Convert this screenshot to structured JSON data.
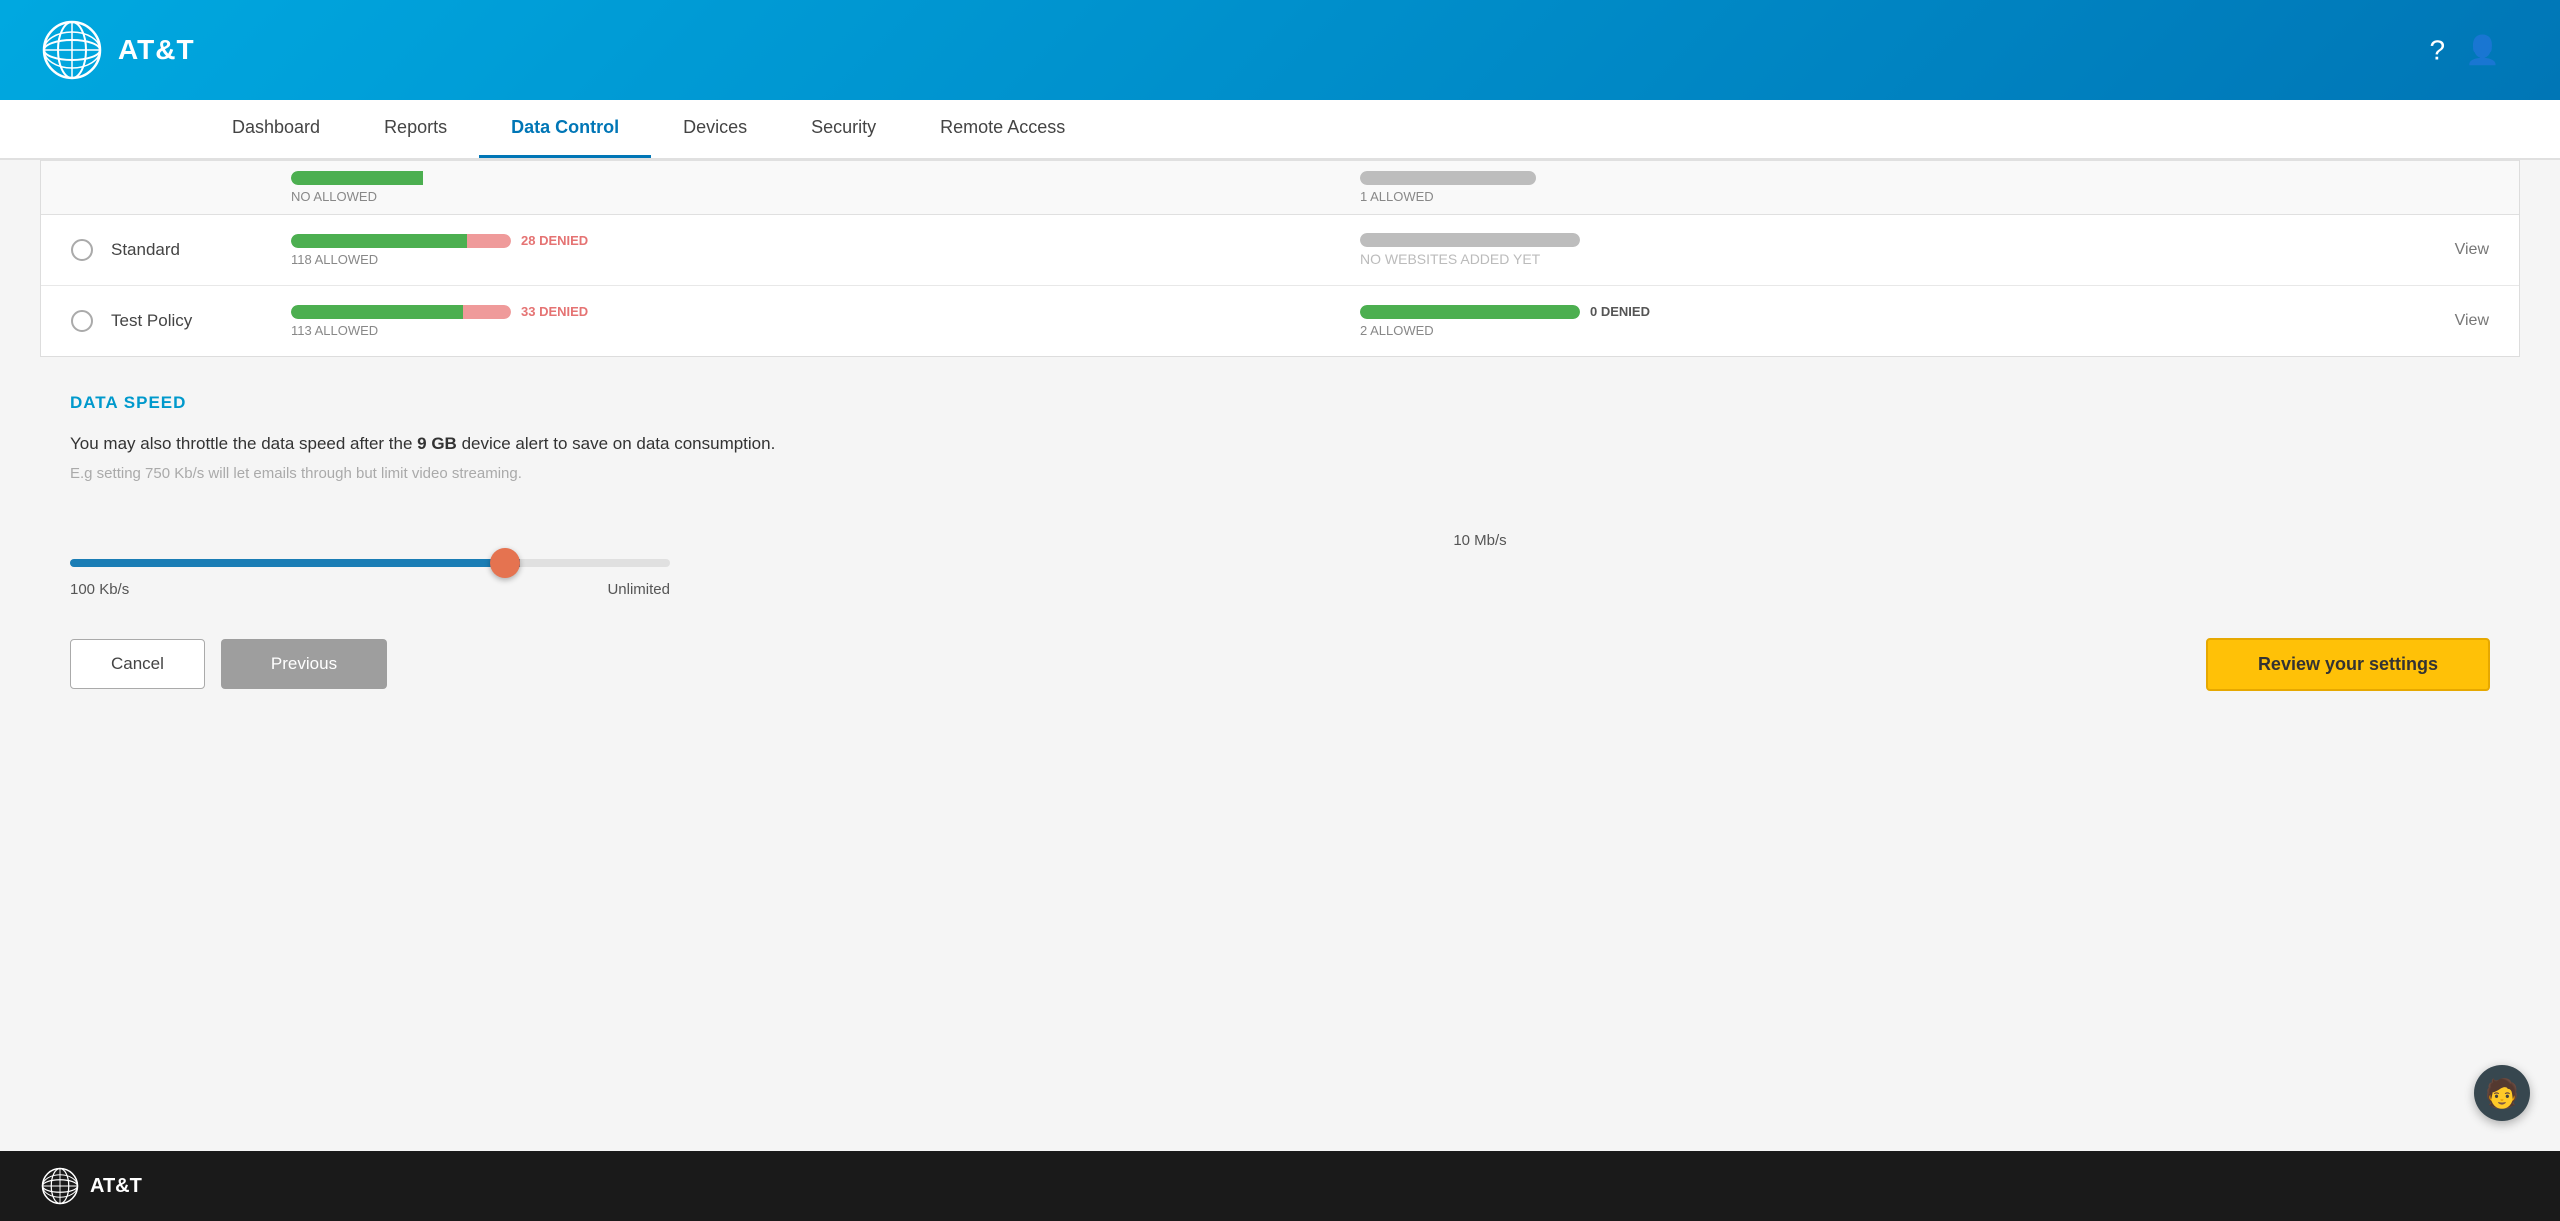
{
  "header": {
    "logo_text": "AT&T",
    "help_icon": "?",
    "user_icon": "👤"
  },
  "nav": {
    "items": [
      {
        "id": "dashboard",
        "label": "Dashboard",
        "active": false
      },
      {
        "id": "reports",
        "label": "Reports",
        "active": false
      },
      {
        "id": "data-control",
        "label": "Data Control",
        "active": true
      },
      {
        "id": "devices",
        "label": "Devices",
        "active": false
      },
      {
        "id": "security",
        "label": "Security",
        "active": false
      },
      {
        "id": "remote-access",
        "label": "Remote Access",
        "active": false
      }
    ]
  },
  "partial_row": {
    "left_text": "NO ALLOWED",
    "right_text": "1 ALLOWED"
  },
  "table": {
    "rows": [
      {
        "id": "standard",
        "name": "Standard",
        "allowed_count": "118 ALLOWED",
        "denied_count": "28 DENIED",
        "websites_label": "NO WEBSITES ADDED YET",
        "websites_type": "none",
        "view_label": "View"
      },
      {
        "id": "test-policy",
        "name": "Test Policy",
        "allowed_count": "113 ALLOWED",
        "denied_count": "33 DENIED",
        "websites_allowed": "2 ALLOWED",
        "websites_denied": "0 DENIED",
        "websites_type": "bar",
        "view_label": "View"
      }
    ]
  },
  "data_speed": {
    "section_title": "DATA SPEED",
    "description_before": "You may also throttle the data speed after the ",
    "description_bold": "9 GB",
    "description_after": " device alert to save on data consumption.",
    "hint": "E.g setting 750 Kb/s will let emails through but limit video streaming.",
    "slider_label": "10 Mb/s",
    "slider_min": "100 Kb/s",
    "slider_max": "Unlimited",
    "slider_value": 75
  },
  "buttons": {
    "cancel": "Cancel",
    "previous": "Previous",
    "review": "Review your settings"
  },
  "footer": {
    "logo_text": "AT&T"
  }
}
